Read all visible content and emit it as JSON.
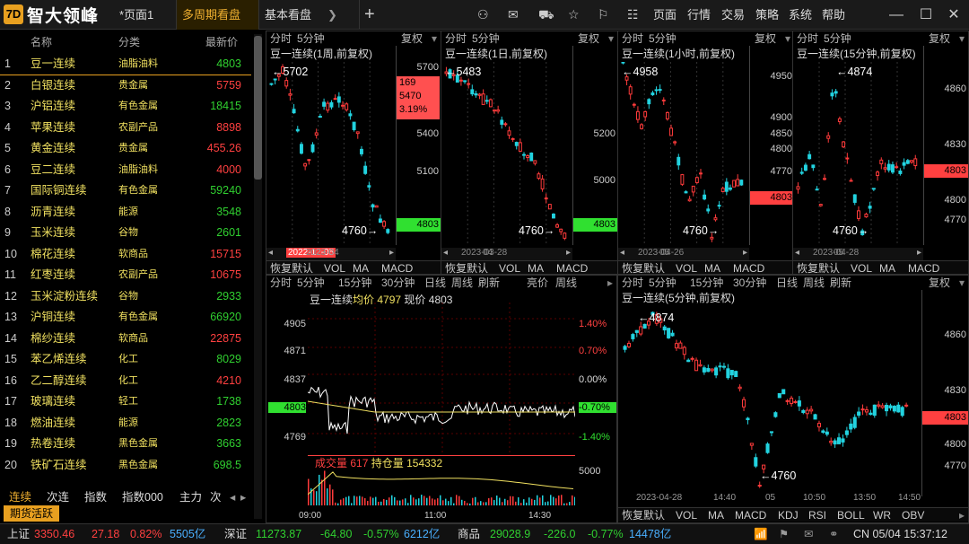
{
  "app": {
    "name": "智大领峰"
  },
  "tabs": [
    {
      "label": "*页面1"
    },
    {
      "label": "多周期看盘"
    },
    {
      "label": "基本看盘"
    }
  ],
  "menu": {
    "page": "页面",
    "quotes": "行情",
    "trade": "交易",
    "strategy": "策略",
    "system": "系统",
    "help": "帮助"
  },
  "icons": {
    "user": "user-icon",
    "wallet": "wallet-icon",
    "minimize": "minimize-icon",
    "maximize": "maximize-icon",
    "close": "close-icon"
  },
  "list": {
    "headers": {
      "name": "名称",
      "category": "分类",
      "price": "最新价"
    },
    "rows": [
      {
        "n": "1",
        "name": "豆一连续",
        "cat": "油脂油料",
        "price": "4803",
        "dir": "dn"
      },
      {
        "n": "2",
        "name": "白银连续",
        "cat": "贵金属",
        "price": "5759",
        "dir": "up"
      },
      {
        "n": "3",
        "name": "沪铝连续",
        "cat": "有色金属",
        "price": "18415",
        "dir": "dn"
      },
      {
        "n": "4",
        "name": "苹果连续",
        "cat": "农副产品",
        "price": "8898",
        "dir": "up"
      },
      {
        "n": "5",
        "name": "黄金连续",
        "cat": "贵金属",
        "price": "455.26",
        "dir": "up"
      },
      {
        "n": "6",
        "name": "豆二连续",
        "cat": "油脂油料",
        "price": "4000",
        "dir": "up"
      },
      {
        "n": "7",
        "name": "国际铜连续",
        "cat": "有色金属",
        "price": "59240",
        "dir": "dn"
      },
      {
        "n": "8",
        "name": "沥青连续",
        "cat": "能源",
        "price": "3548",
        "dir": "dn"
      },
      {
        "n": "9",
        "name": "玉米连续",
        "cat": "谷物",
        "price": "2601",
        "dir": "dn"
      },
      {
        "n": "10",
        "name": "棉花连续",
        "cat": "软商品",
        "price": "15715",
        "dir": "up"
      },
      {
        "n": "11",
        "name": "红枣连续",
        "cat": "农副产品",
        "price": "10675",
        "dir": "up"
      },
      {
        "n": "12",
        "name": "玉米淀粉连续",
        "cat": "谷物",
        "price": "2933",
        "dir": "dn"
      },
      {
        "n": "13",
        "name": "沪铜连续",
        "cat": "有色金属",
        "price": "66920",
        "dir": "dn"
      },
      {
        "n": "14",
        "name": "棉纱连续",
        "cat": "软商品",
        "price": "22875",
        "dir": "up"
      },
      {
        "n": "15",
        "name": "苯乙烯连续",
        "cat": "化工",
        "price": "8029",
        "dir": "dn"
      },
      {
        "n": "16",
        "name": "乙二醇连续",
        "cat": "化工",
        "price": "4210",
        "dir": "up"
      },
      {
        "n": "17",
        "name": "玻璃连续",
        "cat": "轻工",
        "price": "1738",
        "dir": "dn"
      },
      {
        "n": "18",
        "name": "燃油连续",
        "cat": "能源",
        "price": "2823",
        "dir": "dn"
      },
      {
        "n": "19",
        "name": "热卷连续",
        "cat": "黑色金属",
        "price": "3663",
        "dir": "dn"
      },
      {
        "n": "20",
        "name": "铁矿石连续",
        "cat": "黑色金属",
        "price": "698.5",
        "dir": "dn"
      }
    ],
    "bottom_tabs": [
      "连续",
      "次连",
      "指数",
      "指数000",
      "主力",
      "次"
    ],
    "hot_label": "期货活跃"
  },
  "pane_toolbar": {
    "tf": "分时",
    "m5": "5分钟",
    "adj": "复权",
    "m15": "15分钟",
    "m30": "30分钟",
    "day": "日线",
    "week": "周线",
    "refresh": "刷新",
    "bright": "亮价"
  },
  "pane_bottom": {
    "reset": "恢复默认",
    "vol": "VOL",
    "ma": "MA",
    "macd": "MACD",
    "kdj": "KDJ",
    "rsi": "RSI",
    "boll": "BOLL",
    "wr": "WR",
    "obv": "OBV"
  },
  "p1": {
    "title": "豆一连续(1周,前复权)",
    "y": [
      "5700",
      "5400",
      "5100"
    ],
    "hi": "5702",
    "lo": "4760",
    "last": "4803",
    "info": [
      "169",
      "5470",
      "3.19%"
    ],
    "d1": "2022-12-05",
    "d2": "2023-04"
  },
  "p2": {
    "title": "豆一连续(1日,前复权)",
    "y": [
      "5200",
      "5000"
    ],
    "hi": "5483",
    "lo": "4760",
    "last": "4803",
    "d1": "2023-03-28",
    "d2": "04"
  },
  "p3": {
    "title": "豆一连续(1小时,前复权)",
    "y": [
      "4950",
      "4900",
      "4850",
      "4800",
      "4770"
    ],
    "hi": "4958",
    "lo": "4760",
    "last": "4803",
    "d1": "2023-04-26",
    "d2": "05"
  },
  "p4": {
    "title": "豆一连续(15分钟,前复权)",
    "y": [
      "4860",
      "4830",
      "4800",
      "4770"
    ],
    "hi": "4874",
    "lo": "4760",
    "last": "4803",
    "d1": "2023-04-28",
    "d2": "05"
  },
  "p5": {
    "title": "豆一连续",
    "avg_label": "均价",
    "avg": "4797",
    "now_label": "现价",
    "now": "4803",
    "y": [
      "4905",
      "4871",
      "4837",
      "4803",
      "4769"
    ],
    "pct": [
      "1.40%",
      "0.70%",
      "0.00%",
      "-0.70%",
      "-1.40%"
    ],
    "vol_label": "成交量",
    "vol": "617",
    "oi_label": "持仓量",
    "oi": "154332",
    "vmax": "5000",
    "t": [
      "09:00",
      "11:00",
      "14:30"
    ]
  },
  "p6": {
    "title": "豆一连续(5分钟,前复权)",
    "y": [
      "4860",
      "4830",
      "4800",
      "4770"
    ],
    "hi": "4874",
    "lo": "4760",
    "last": "4803",
    "t": [
      "2023-04-28",
      "14:40",
      "05",
      "10:50",
      "13:50",
      "14:50"
    ]
  },
  "status": {
    "sh": {
      "label": "上证",
      "v": "3350.46",
      "c": "27.18",
      "p": "0.82%",
      "amt": "5505亿"
    },
    "sz": {
      "label": "深证",
      "v": "11273.87",
      "c": "-64.80",
      "p": "-0.57%",
      "amt": "6212亿"
    },
    "com": {
      "label": "商品",
      "v": "29028.9",
      "c": "-226.0",
      "p": "-0.77%",
      "amt": "14478亿"
    },
    "clock": "CN 05/04 15:37:12"
  }
}
